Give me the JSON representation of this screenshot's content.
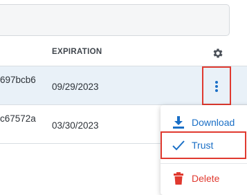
{
  "table": {
    "header": {
      "expiration_label": "EXPIRATION"
    },
    "rows": [
      {
        "id_fragment": "697bcb6",
        "expiration": "09/29/2023",
        "selected": true
      },
      {
        "id_fragment": "c67572a",
        "expiration": "03/30/2023",
        "selected": false
      }
    ]
  },
  "row_menu": {
    "items": [
      {
        "label": "Download",
        "icon": "download-icon",
        "color": "#1a6fc6"
      },
      {
        "label": "Trust",
        "icon": "check-icon",
        "color": "#1a6fc6"
      },
      {
        "label": "Delete",
        "icon": "trash-icon",
        "color": "#e0392f"
      }
    ]
  },
  "colors": {
    "accent": "#1a6fc6",
    "danger": "#e0392f",
    "selected_row": "#e9f1f8",
    "highlight_border": "#e0392f"
  }
}
